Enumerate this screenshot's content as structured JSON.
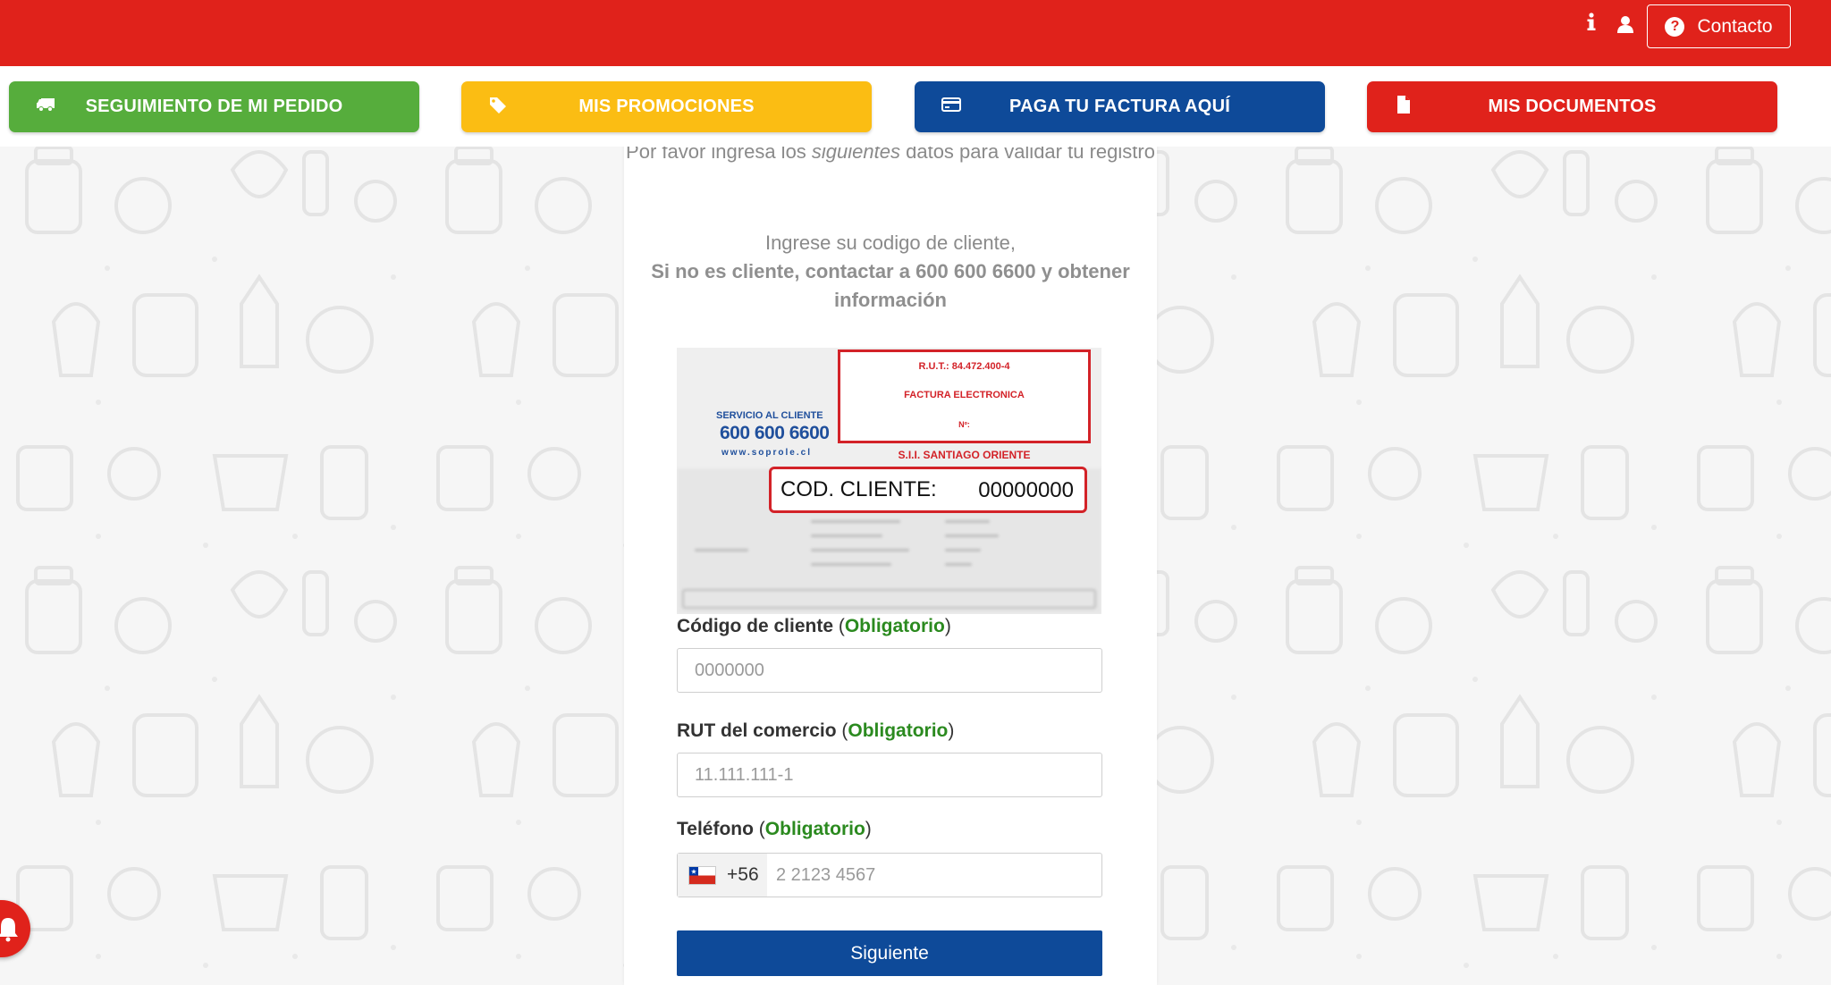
{
  "header": {
    "icons": [
      "info-icon",
      "user-icon"
    ],
    "contact_label": "Contacto",
    "contact_icon": "question-circle-icon",
    "bg_color": "#e0221b"
  },
  "nav": {
    "items": [
      {
        "label": "SEGUIMIENTO DE MI PEDIDO",
        "icon": "truck-icon",
        "color": "#56ad3c"
      },
      {
        "label": "MIS PROMOCIONES",
        "icon": "tag-icon",
        "color": "#fbbd13"
      },
      {
        "label": "PAGA TU FACTURA AQUÍ",
        "icon": "credit-card-icon",
        "color": "#0e4a99"
      },
      {
        "label": "MIS DOCUMENTOS",
        "icon": "document-icon",
        "color": "#e0221b"
      }
    ]
  },
  "card": {
    "intro_before": "Por favor ingresa los ",
    "intro_em": "siguientes",
    "intro_after": " datos para validar tu registro",
    "client_info_1": "Ingrese su codigo de cliente,",
    "client_info_2": "Si no es cliente, contactar a 600 600 6600 y obtener información"
  },
  "invoice_image": {
    "rut": "R.U.T.: 84.472.400-4",
    "doc_type": "FACTURA ELECTRONICA",
    "number_label": "Nº:",
    "service_label": "SERVICIO AL CLIENTE",
    "service_phone": "600 600 6600",
    "website": "www.soprole.cl",
    "sii": "S.I.I. SANTIAGO ORIENTE",
    "cod_label": "COD. CLIENTE:",
    "cod_value": "00000000"
  },
  "form": {
    "required_label": "Obligatorio",
    "client_code": {
      "label": "Código de cliente",
      "placeholder": "0000000"
    },
    "rut": {
      "label": "RUT del comercio",
      "placeholder": "11.111.111-1"
    },
    "phone": {
      "label": "Teléfono",
      "country_code": "+56",
      "placeholder": "2 2123 4567",
      "flag": "chile-flag-icon"
    },
    "submit_label": "Siguiente"
  },
  "floating": {
    "icon": "bell-icon"
  }
}
